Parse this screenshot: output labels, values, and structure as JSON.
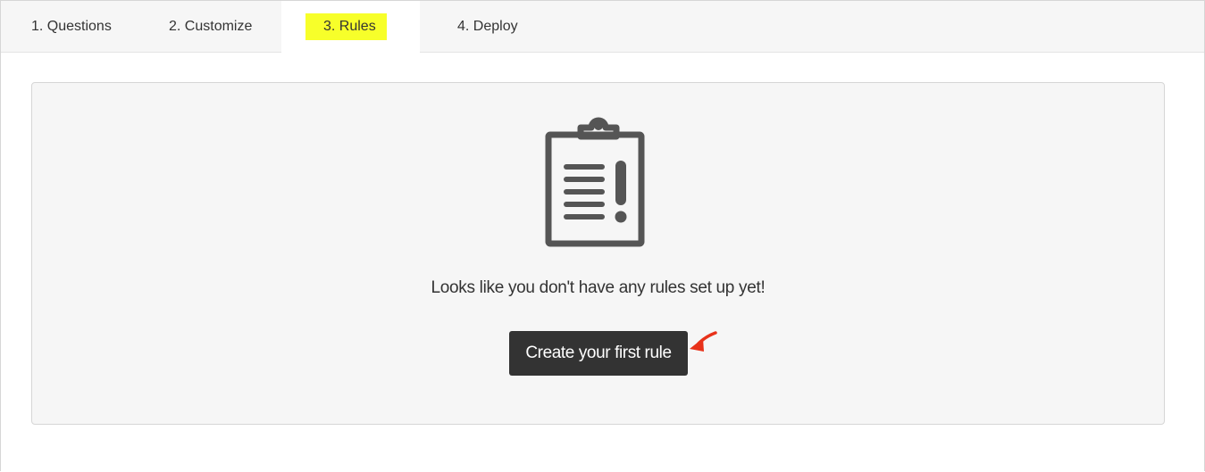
{
  "tabs": [
    {
      "label": "1. Questions",
      "active": false
    },
    {
      "label": "2. Customize",
      "active": false
    },
    {
      "label": "3. Rules",
      "active": true
    },
    {
      "label": "4. Deploy",
      "active": false
    }
  ],
  "empty_state": {
    "icon": "clipboard-alert-icon",
    "message": "Looks like you don't have any rules set up yet!",
    "button_label": "Create your first rule"
  },
  "annotation": {
    "icon": "red-arrow-icon"
  },
  "colors": {
    "highlight": "#f7ff2a",
    "button_bg": "#333333",
    "icon": "#555555",
    "arrow": "#e8321a"
  }
}
